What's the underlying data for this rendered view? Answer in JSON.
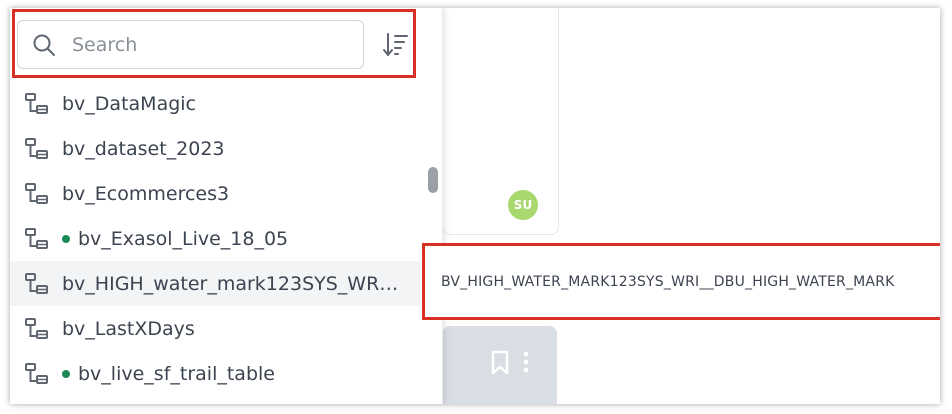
{
  "search": {
    "placeholder": "Search"
  },
  "card": {
    "avatar_initials": "SU"
  },
  "datasets": [
    {
      "label": "bv_DataMagic",
      "live": false
    },
    {
      "label": "bv_dataset_2023",
      "live": false
    },
    {
      "label": "bv_Ecommerces3",
      "live": false
    },
    {
      "label": "bv_Exasol_Live_18_05",
      "live": true
    },
    {
      "label": "bv_HIGH_water_mark123SYS_WRI...",
      "live": false,
      "hovered": true
    },
    {
      "label": "bv_LastXDays",
      "live": false
    },
    {
      "label": "bv_live_sf_trail_table",
      "live": true
    }
  ],
  "tooltip": {
    "text": "BV_HIGH_WATER_MARK123SYS_WRI__DBU_HIGH_WATER_MARK"
  },
  "colors": {
    "highlight": "#d93025",
    "live_dot": "#1a8a55",
    "avatar": "#a8d86e"
  },
  "icons": {
    "search": "search-icon",
    "sort": "sort-icon",
    "dataset": "table-view-icon",
    "bookmark": "bookmark-icon",
    "more": "kebab-icon"
  }
}
